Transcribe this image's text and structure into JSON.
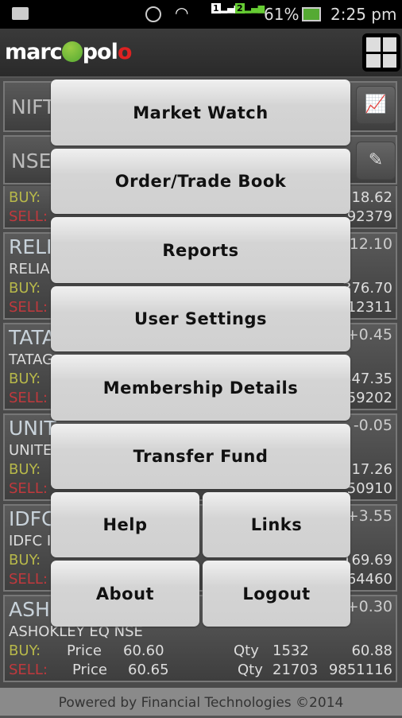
{
  "status_bar": {
    "battery": "61%",
    "time": "2:25 pm",
    "sim1": "1",
    "sim2": "2"
  },
  "header": {
    "logo": "marcopolo",
    "menu_icon": "grid-icon"
  },
  "list": {
    "index1": "NIFT",
    "index2": "NSEI",
    "rows": [
      {
        "symbol": "",
        "name": "",
        "change": "",
        "buy_label": "BUY:",
        "sell_label": "SELL:",
        "buy_right": "518.62",
        "sell_right": "92379"
      },
      {
        "symbol": "RELI",
        "name": "RELIA",
        "change": "-12.10",
        "buy_label": "BUY:",
        "sell_label": "SELL:",
        "buy_right": "376.70",
        "sell_right": "12311"
      },
      {
        "symbol": "TATA",
        "name": "TATAG",
        "change": "+0.45",
        "buy_label": "BUY:",
        "sell_label": "SELL:",
        "buy_right": "447.35",
        "sell_right": "59202"
      },
      {
        "symbol": "UNIT",
        "name": "UNITE",
        "change": "-0.05",
        "buy_label": "BUY:",
        "sell_label": "SELL:",
        "buy_right": "17.26",
        "sell_right": "50910"
      },
      {
        "symbol": "IDFC",
        "name": "IDFC I",
        "change": "+3.55",
        "buy_label": "BUY:",
        "sell_label": "SELL:",
        "buy_right": "169.69",
        "sell_right": "64460"
      },
      {
        "symbol": "ASH",
        "name": "ASHOKLEY EQ NSE",
        "change": "+0.30",
        "buy_label": "BUY:",
        "sell_label": "SELL:",
        "buy_right": "60.88",
        "sell_right": "9851116",
        "buy_price_label": "Price",
        "buy_price": "60.60",
        "buy_qty_label": "Qty",
        "buy_qty": "1532",
        "sell_price_label": "Price",
        "sell_price": "60.65",
        "sell_qty_label": "Qty",
        "sell_qty": "21703"
      }
    ]
  },
  "menu": {
    "items": [
      "Market Watch",
      "Order/Trade Book",
      "Reports",
      "User Settings",
      "Membership Details",
      "Transfer Fund",
      "Help",
      "Links",
      "About",
      "Logout"
    ]
  },
  "footer": {
    "text": "Powered by Financial Technologies ©2014"
  }
}
